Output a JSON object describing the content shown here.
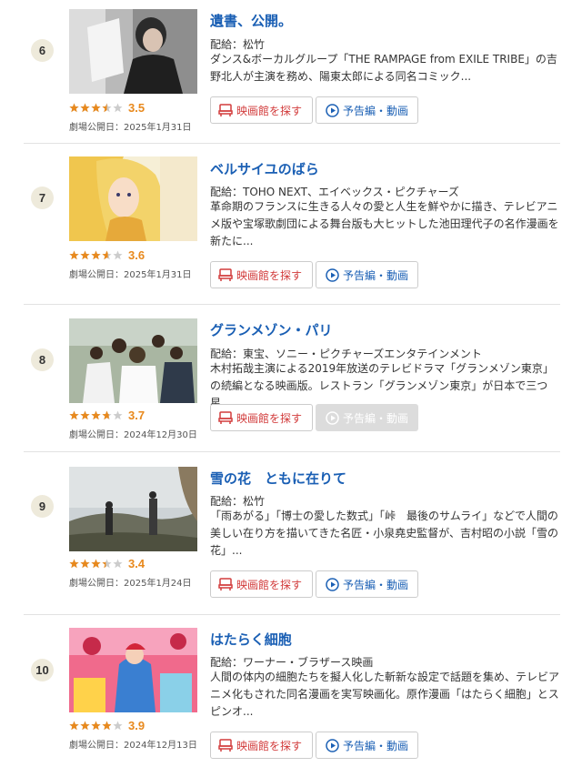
{
  "colors": {
    "title": "#1a5fb4",
    "score": "#e8891d",
    "theater": "#d23c3c",
    "rank_bg": "#eeeadb",
    "star_on": "#e8891d",
    "star_off": "#cccccc"
  },
  "labels": {
    "release_prefix": "劇場公開日：",
    "distributor_prefix": "配給：",
    "theater_button": "映画館を探す",
    "trailer_button": "予告編・動画"
  },
  "movies": [
    {
      "rank": "6",
      "title": "遺書、公開。",
      "rating": "3.5",
      "rating_value": 3.5,
      "release_date": "劇場公開日：2025年1月31日",
      "distributor": "配給：松竹",
      "description": "ダンス&ボーカルグループ「THE RAMPAGE from EXILE TRIBE」の吉野北人が主演を務め、陽東太郎による同名コミック...",
      "trailer_available": true
    },
    {
      "rank": "7",
      "title": "ベルサイユのばら",
      "rating": "3.6",
      "rating_value": 3.6,
      "release_date": "劇場公開日：2025年1月31日",
      "distributor": "配給：TOHO NEXT、エイベックス・ピクチャーズ",
      "description": "革命期のフランスに生きる人々の愛と人生を鮮やかに描き、テレビアニメ版や宝塚歌劇団による舞台版も大ヒットした池田理代子の名作漫画を新たに...",
      "trailer_available": true
    },
    {
      "rank": "8",
      "title": "グランメゾン・パリ",
      "rating": "3.7",
      "rating_value": 3.7,
      "release_date": "劇場公開日：2024年12月30日",
      "distributor": "配給：東宝、ソニー・ピクチャーズエンタテインメント",
      "description": "木村拓哉主演による2019年放送のテレビドラマ「グランメゾン東京」の続編となる映画版。レストラン「グランメゾン東京」が日本で三つ星...",
      "trailer_available": false
    },
    {
      "rank": "9",
      "title": "雪の花　ともに在りて",
      "rating": "3.4",
      "rating_value": 3.4,
      "release_date": "劇場公開日：2025年1月24日",
      "distributor": "配給：松竹",
      "description": "「雨あがる」「博士の愛した数式」「峠　最後のサムライ」などで人間の美しい在り方を描いてきた名匠・小泉堯史監督が、吉村昭の小説「雪の花」...",
      "trailer_available": true
    },
    {
      "rank": "10",
      "title": "はたらく細胞",
      "rating": "3.9",
      "rating_value": 3.9,
      "release_date": "劇場公開日：2024年12月13日",
      "distributor": "配給：ワーナー・ブラザース映画",
      "description": "人間の体内の細胞たちを擬人化した斬新な設定で話題を集め、テレビアニメ化もされた同名漫画を実写映画化。原作漫画「はたらく細胞」とスピンオ...",
      "trailer_available": true
    }
  ]
}
